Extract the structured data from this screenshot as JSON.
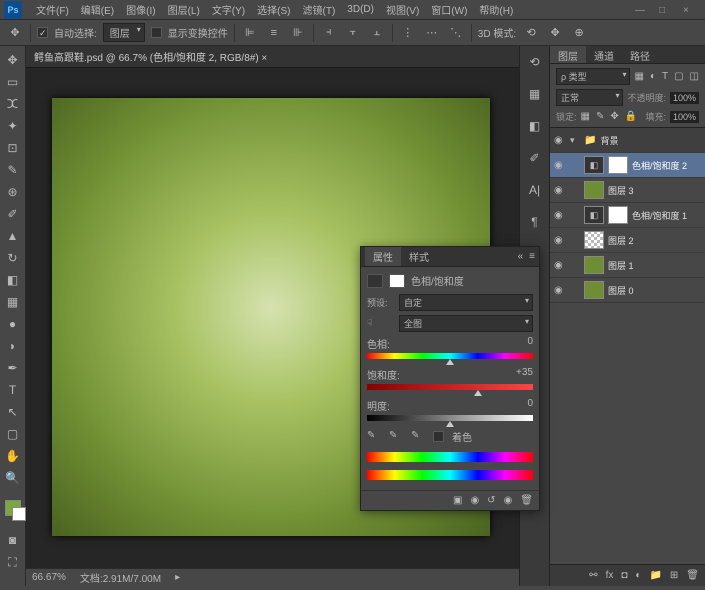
{
  "app": {
    "logo": "Ps"
  },
  "menu": [
    "文件(F)",
    "编辑(E)",
    "图像(I)",
    "图层(L)",
    "文字(Y)",
    "选择(S)",
    "滤镜(T)",
    "3D(D)",
    "视图(V)",
    "窗口(W)",
    "帮助(H)"
  ],
  "optbar": {
    "auto_select_label": "自动选择:",
    "auto_select_target": "图层",
    "show_transform": "显示变换控件",
    "mode_3d": "3D 模式:"
  },
  "doc": {
    "tab": "鳄鱼高跟鞋.psd @ 66.7% (色相/饱和度 2, RGB/8#) ×"
  },
  "status": {
    "zoom": "66.67%",
    "docinfo": "文档:2.91M/7.00M"
  },
  "panels": {
    "tabs": [
      "图层",
      "通道",
      "路径"
    ],
    "kind_label": "ρ 类型",
    "blend": "正常",
    "opacity_label": "不透明度:",
    "opacity_val": "100%",
    "fill_label": "填充:",
    "fill_val": "100%",
    "lock_label": "锁定:"
  },
  "layers": [
    {
      "type": "group",
      "name": "背景"
    },
    {
      "type": "adj",
      "name": "色相/饱和度 2",
      "sel": true
    },
    {
      "type": "img",
      "name": "图层 3"
    },
    {
      "type": "adj",
      "name": "色相/饱和度 1"
    },
    {
      "type": "chk",
      "name": "图层 2"
    },
    {
      "type": "img",
      "name": "图层 1"
    },
    {
      "type": "green",
      "name": "图层 0"
    }
  ],
  "props": {
    "tabs": [
      "属性",
      "样式"
    ],
    "title": "色相/饱和度",
    "preset_label": "预设:",
    "preset_value": "自定",
    "channel_value": "全图",
    "hue_label": "色相:",
    "hue_value": "0",
    "sat_label": "饱和度:",
    "sat_value": "+35",
    "light_label": "明度:",
    "light_value": "0",
    "colorize_label": "着色"
  }
}
